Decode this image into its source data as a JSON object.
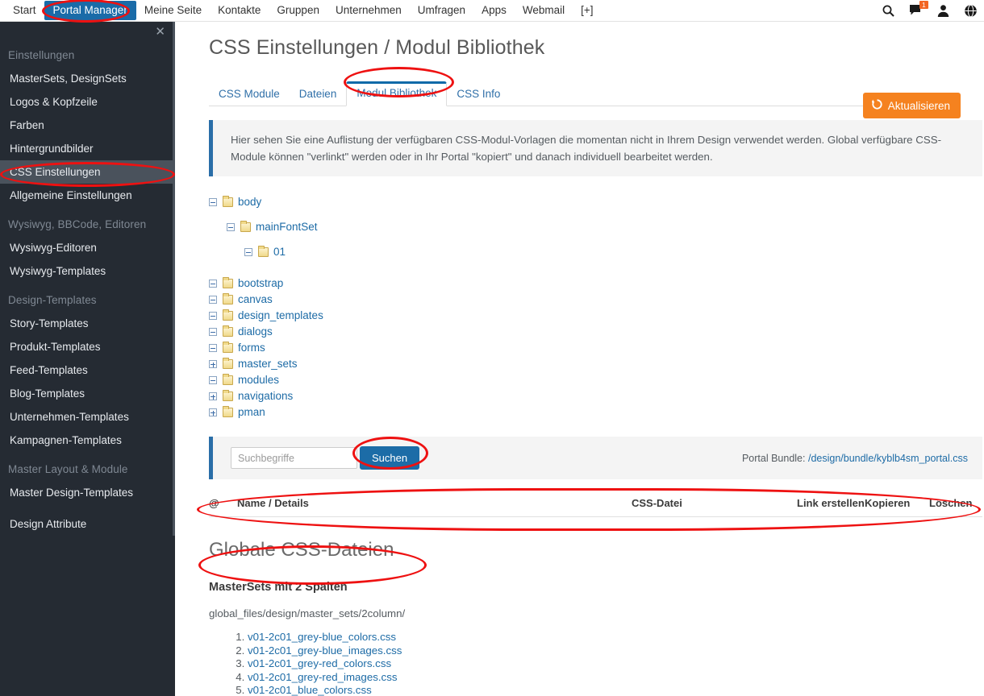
{
  "topnav": {
    "items": [
      {
        "label": "Start",
        "active": false
      },
      {
        "label": "Portal Manager",
        "active": true
      },
      {
        "label": "Meine Seite",
        "active": false
      },
      {
        "label": "Kontakte",
        "active": false
      },
      {
        "label": "Gruppen",
        "active": false
      },
      {
        "label": "Unternehmen",
        "active": false
      },
      {
        "label": "Umfragen",
        "active": false
      },
      {
        "label": "Apps",
        "active": false
      },
      {
        "label": "Webmail",
        "active": false
      },
      {
        "label": "[+]",
        "active": false
      }
    ],
    "icons": [
      {
        "name": "search-icon"
      },
      {
        "name": "messages-icon",
        "badge": "1"
      },
      {
        "name": "user-icon"
      },
      {
        "name": "globe-icon"
      }
    ],
    "active_color": "#1a6ba8",
    "badge_color": "#f26522"
  },
  "sidebar": {
    "close_label": "✕",
    "blocks": [
      {
        "group": "Einstellungen",
        "items": [
          {
            "label": "MasterSets, DesignSets",
            "active": false
          },
          {
            "label": "Logos & Kopfzeile",
            "active": false
          },
          {
            "label": "Farben",
            "active": false
          },
          {
            "label": "Hintergrundbilder",
            "active": false
          },
          {
            "label": "CSS Einstellungen",
            "active": true
          },
          {
            "label": "Allgemeine Einstellungen",
            "active": false
          }
        ]
      },
      {
        "group": "Wysiwyg, BBCode, Editoren",
        "items": [
          {
            "label": "Wysiwyg-Editoren",
            "active": false
          },
          {
            "label": "Wysiwyg-Templates",
            "active": false
          }
        ]
      },
      {
        "group": "Design-Templates",
        "items": [
          {
            "label": "Story-Templates",
            "active": false
          },
          {
            "label": "Produkt-Templates",
            "active": false
          },
          {
            "label": "Feed-Templates",
            "active": false
          },
          {
            "label": "Blog-Templates",
            "active": false
          },
          {
            "label": "Unternehmen-Templates",
            "active": false
          },
          {
            "label": "Kampagnen-Templates",
            "active": false
          }
        ]
      },
      {
        "group": "Master Layout & Module",
        "items": [
          {
            "label": "Master Design-Templates",
            "active": false
          },
          {
            "label": "Design Attribute",
            "active": false,
            "spacer_before": true
          }
        ]
      }
    ],
    "background": "#252b33",
    "active_background": "#4a525c"
  },
  "main": {
    "page_title": "CSS Einstellungen / Modul Bibliothek",
    "tabs": [
      {
        "label": "CSS Module",
        "active": false
      },
      {
        "label": "Dateien",
        "active": false
      },
      {
        "label": "Modul Bibliothek",
        "active": true
      },
      {
        "label": "CSS Info",
        "active": false
      }
    ],
    "refresh_button": "Aktualisieren",
    "refresh_icon": "refresh-icon",
    "refresh_color": "#f5821f",
    "info_text": "Hier sehen Sie eine Auflistung der verfügbaren CSS-Modul-Vorlagen die momentan nicht in Ihrem Design verwendet werden. Global verfügbare CSS-Module können \"verlinkt\" werden oder in Ihr Portal \"kopiert\" und danach individuell bearbeitet werden.",
    "tree": [
      {
        "label": "body",
        "state": "minus",
        "indent": 0
      },
      {
        "label": "mainFontSet",
        "state": "minus",
        "indent": 1
      },
      {
        "label": "01",
        "state": "minus",
        "indent": 2
      },
      {
        "label": "bootstrap",
        "state": "minus",
        "indent": 0,
        "gap": true
      },
      {
        "label": "canvas",
        "state": "minus",
        "indent": 0
      },
      {
        "label": "design_templates",
        "state": "minus",
        "indent": 0
      },
      {
        "label": "dialogs",
        "state": "minus",
        "indent": 0
      },
      {
        "label": "forms",
        "state": "minus",
        "indent": 0
      },
      {
        "label": "master_sets",
        "state": "plus",
        "indent": 0
      },
      {
        "label": "modules",
        "state": "minus",
        "indent": 0
      },
      {
        "label": "navigations",
        "state": "plus",
        "indent": 0
      },
      {
        "label": "pman",
        "state": "plus",
        "indent": 0
      }
    ],
    "search": {
      "placeholder": "Suchbegriffe",
      "value": "",
      "button": "Suchen",
      "bundle_label": "Portal Bundle:",
      "bundle_path": "/design/bundle/kyblb4sm_portal.css"
    },
    "table_headers": {
      "at": "@",
      "name": "Name / Details",
      "css_file": "CSS-Datei",
      "link": "Link erstellen",
      "copy": "Kopieren",
      "delete": "Löschen"
    },
    "globals": {
      "heading": "Globale CSS-Dateien",
      "subheading": "MasterSets mit 2 Spalten",
      "path": "global_files/design/master_sets/2column/",
      "files": [
        "v01-2c01_grey-blue_colors.css",
        "v01-2c01_grey-blue_images.css",
        "v01-2c01_grey-red_colors.css",
        "v01-2c01_grey-red_images.css",
        "v01-2c01_blue_colors.css"
      ]
    }
  },
  "annotations": {
    "color": "#ee1111",
    "targets": [
      "portal-manager-tab",
      "sidebar-item-css-einstellungen",
      "tab-modul-bibliothek",
      "search-button",
      "table-header-row",
      "globale-css-dateien-heading"
    ]
  }
}
